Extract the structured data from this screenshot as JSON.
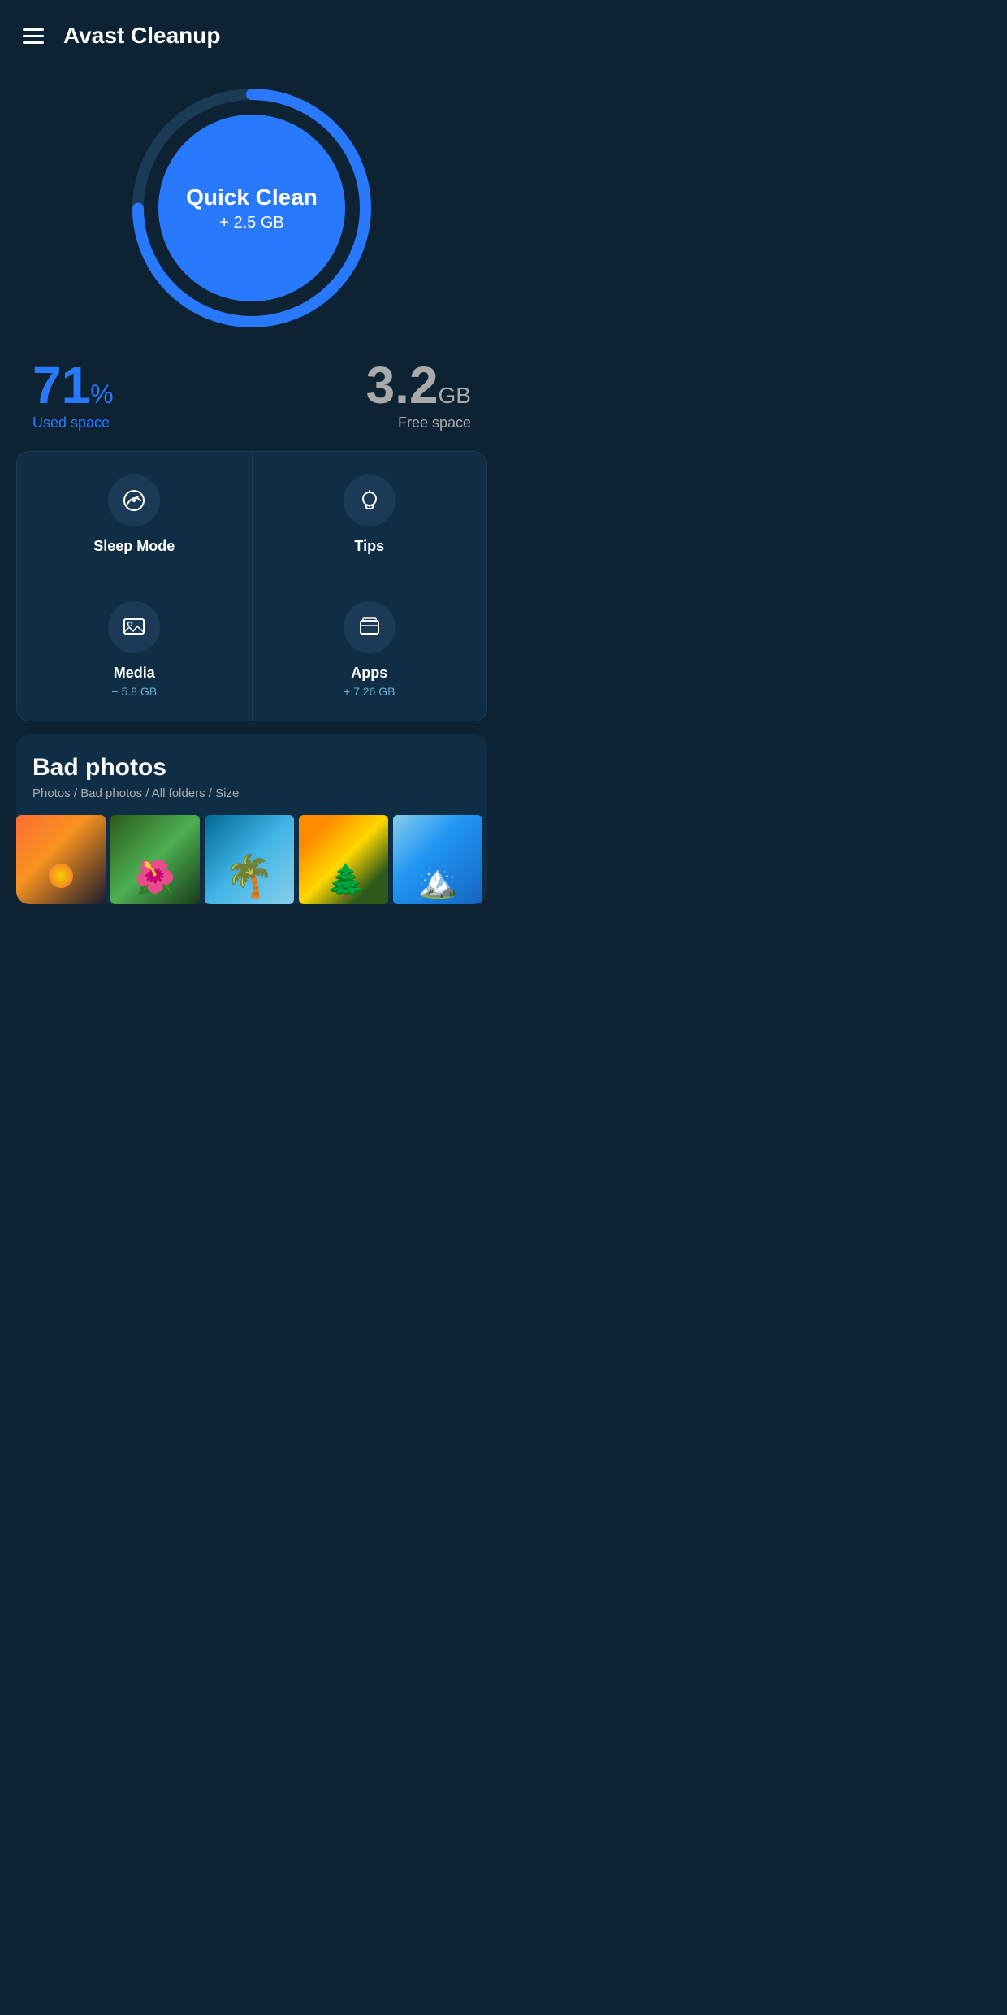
{
  "header": {
    "title": "Avast Cleanup",
    "menu_icon_label": "menu"
  },
  "quick_clean": {
    "label": "Quick Clean",
    "size": "+ 2.5 GB"
  },
  "stats": {
    "used_space_percent": "71",
    "used_space_unit": "%",
    "used_space_label": "Used space",
    "free_space_value": "3.2",
    "free_space_unit": "GB",
    "free_space_label": "Free space"
  },
  "features": {
    "sleep_mode_label": "Sleep Mode",
    "tips_label": "Tips",
    "media_label": "Media",
    "media_sub": "+ 5.8 GB",
    "apps_label": "Apps",
    "apps_sub": "+ 7.26 GB"
  },
  "bad_photos": {
    "title": "Bad photos",
    "breadcrumb": "Photos  /  Bad photos  /  All folders  /  Size",
    "photos": [
      {
        "id": 1,
        "class": "photo-1"
      },
      {
        "id": 2,
        "class": "photo-2"
      },
      {
        "id": 3,
        "class": "photo-3"
      },
      {
        "id": 4,
        "class": "photo-4"
      },
      {
        "id": 5,
        "class": "photo-5"
      }
    ]
  },
  "colors": {
    "accent": "#2979ff",
    "background": "#0d2233",
    "card": "#0f2d45"
  }
}
